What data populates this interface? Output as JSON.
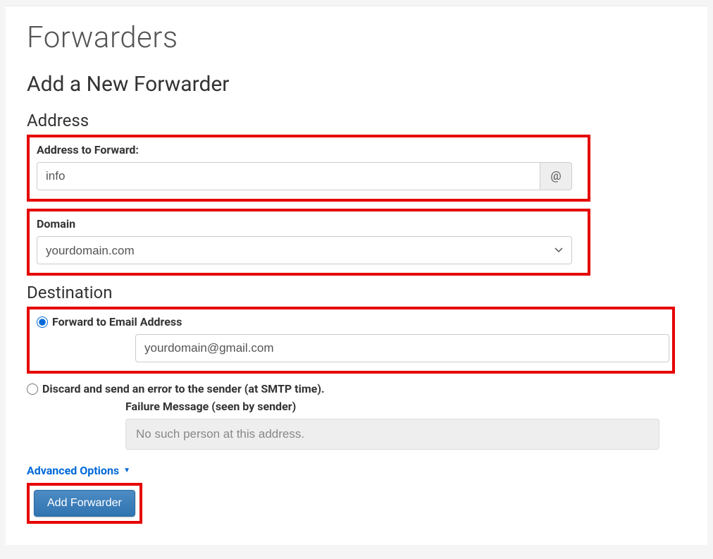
{
  "page": {
    "title": "Forwarders",
    "subtitle": "Add a New Forwarder"
  },
  "address_section": {
    "heading": "Address",
    "forward_label": "Address to Forward:",
    "forward_value": "info",
    "at_symbol": "@",
    "domain_label": "Domain",
    "domain_value": "yourdomain.com"
  },
  "destination_section": {
    "heading": "Destination",
    "option_forward": {
      "label": "Forward to Email Address",
      "value": "yourdomain@gmail.com",
      "selected": true
    },
    "option_discard": {
      "label": "Discard and send an error to the sender (at SMTP time).",
      "failure_label": "Failure Message (seen by sender)",
      "failure_value": "No such person at this address.",
      "selected": false
    }
  },
  "advanced": {
    "label": "Advanced Options"
  },
  "submit": {
    "label": "Add Forwarder"
  }
}
